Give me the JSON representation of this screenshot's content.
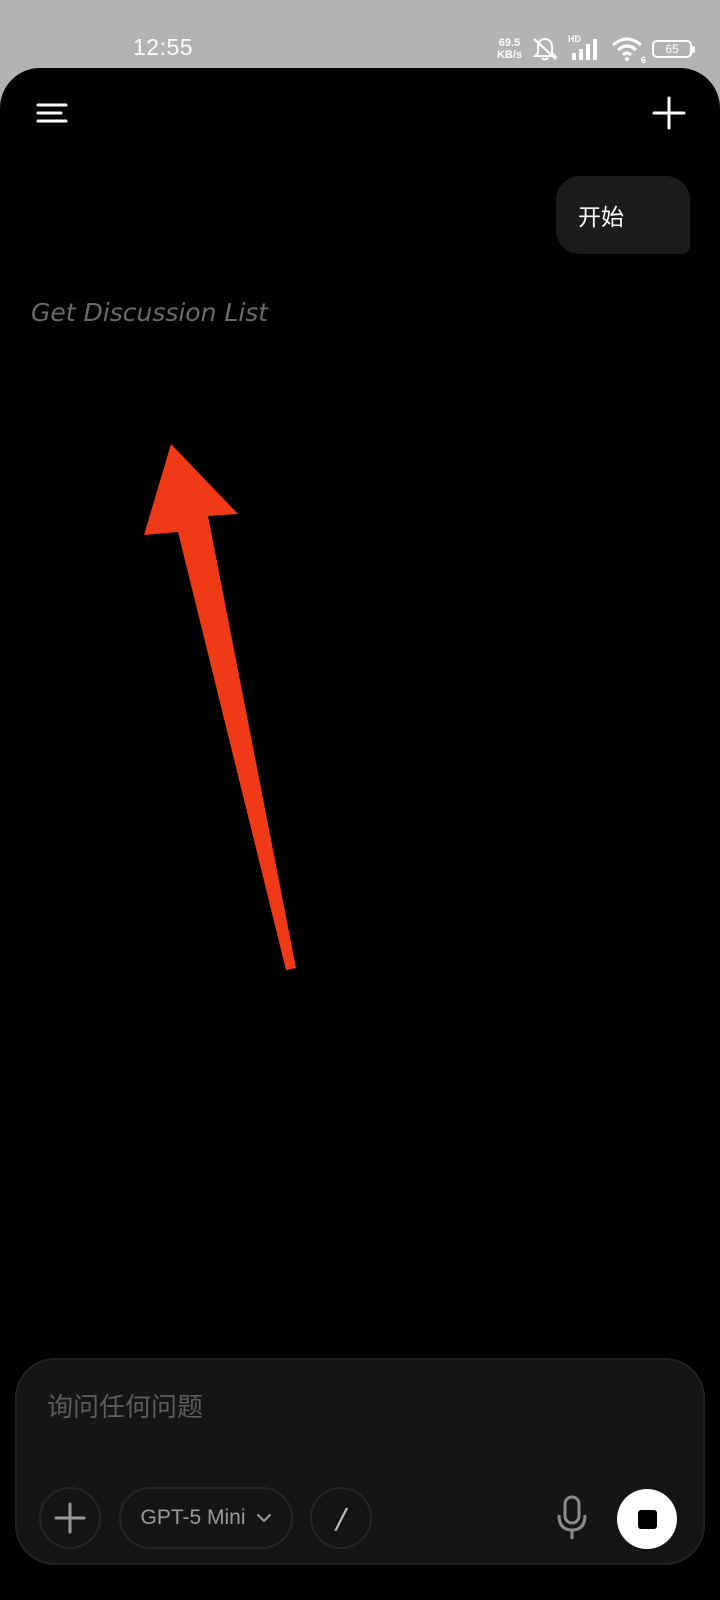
{
  "status_bar": {
    "time": "12:55",
    "net_speed_value": "69.5",
    "net_speed_unit": "KB/s",
    "signal_label": "HD",
    "wifi_label": "6",
    "battery": "65",
    "icons": [
      "mute-bell-icon",
      "signal-icon",
      "wifi-icon",
      "battery-icon"
    ]
  },
  "header": {
    "menu_icon": "menu-icon",
    "new_chat_icon": "plus-icon"
  },
  "chat": {
    "user_message": "开始",
    "status_text": "Get Discussion List"
  },
  "annotation": {
    "arrow_color": "#f03a17"
  },
  "composer": {
    "placeholder": "询问任何问题",
    "model_label": "GPT-5 Mini",
    "tool_label": "/",
    "attach_icon": "plus-icon",
    "mic_icon": "microphone-icon",
    "stop_icon": "stop-icon"
  }
}
